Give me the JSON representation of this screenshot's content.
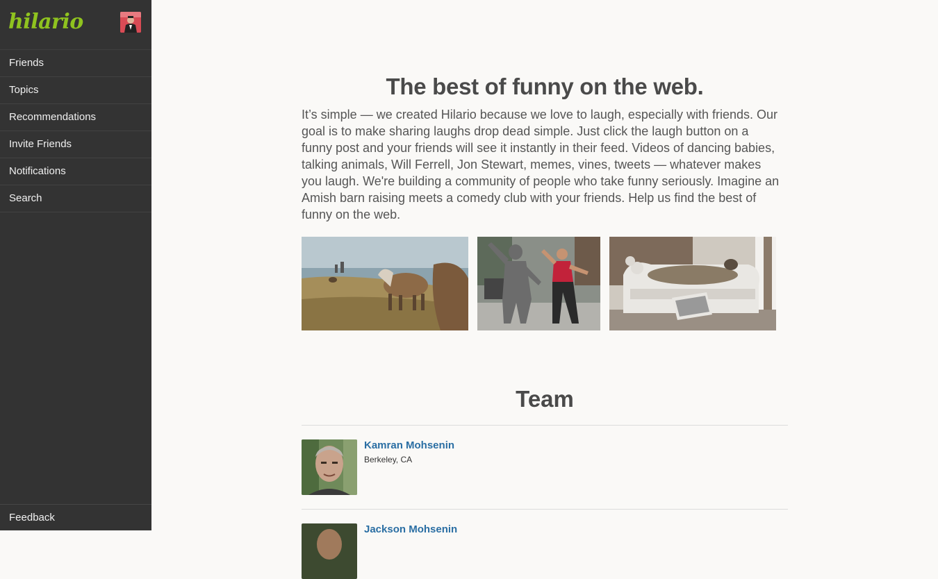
{
  "sidebar": {
    "logo": "hilario",
    "nav": [
      {
        "label": "Friends"
      },
      {
        "label": "Topics"
      },
      {
        "label": "Recommendations"
      },
      {
        "label": "Invite Friends"
      },
      {
        "label": "Notifications"
      },
      {
        "label": "Search"
      }
    ],
    "feedback": "Feedback"
  },
  "main": {
    "headline": "The best of funny on the web.",
    "intro": "It’s simple — we created Hilario because we love to laugh, especially with friends. Our goal is to make sharing laughs drop dead simple. Just click the laugh button on a funny post and your friends will see it instantly in their feed. Videos of dancing babies, talking animals, Will Ferrell, Jon Stewart, memes, vines, tweets — whatever makes you laugh. We're building a community of people who take funny seriously. Imagine an Amish barn raising meets a comedy club with your friends. Help us find the best of funny on the web.",
    "team_title": "Team",
    "team": [
      {
        "name": "Kamran Mohsenin",
        "location": "Berkeley, CA"
      },
      {
        "name": "Jackson Mohsenin",
        "location": ""
      }
    ]
  },
  "colors": {
    "sidebar_bg": "#333333",
    "logo_green": "#8fc31f",
    "link_blue": "#2a6ea3",
    "page_bg": "#faf9f7"
  }
}
